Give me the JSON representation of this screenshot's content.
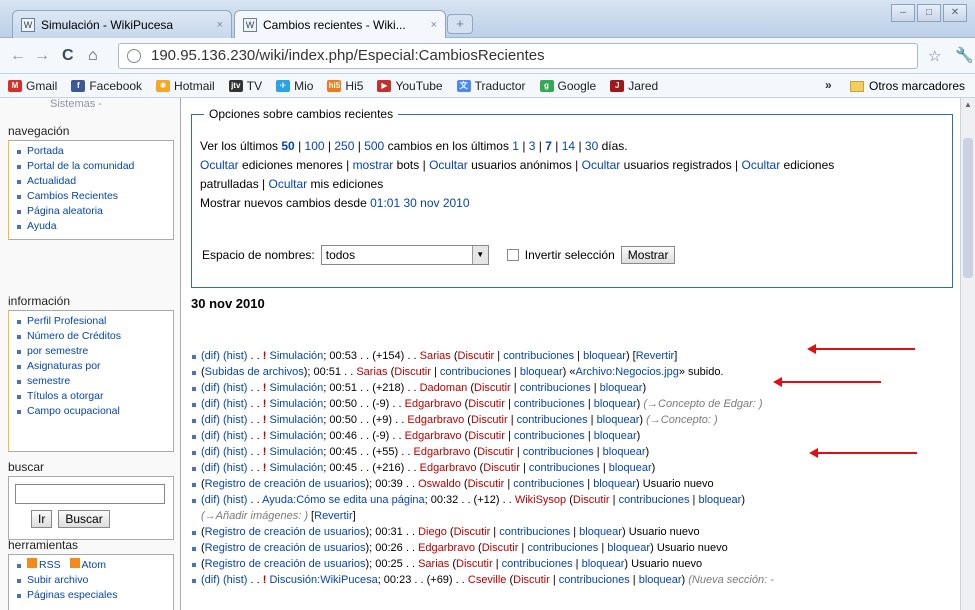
{
  "browser": {
    "tabs": [
      {
        "title": "Simulación - WikiPucesa",
        "close": "×"
      },
      {
        "title": "Cambios recientes - Wiki...",
        "close": "×"
      }
    ],
    "url": "190.95.136.230/wiki/index.php/Especial:CambiosRecientes",
    "bookmarks": [
      "Gmail",
      "Facebook",
      "Hotmail",
      "TV",
      "Mio",
      "Hi5",
      "YouTube",
      "Traductor",
      "Google",
      "Jared"
    ],
    "other_bookmarks": "Otros marcadores"
  },
  "sidebar": {
    "logo_text": "Sistemas -",
    "nav_title": "navegación",
    "nav_items": [
      "Portada",
      "Portal de la comunidad",
      "Actualidad",
      "Cambios Recientes",
      "Página aleatoria",
      "Ayuda"
    ],
    "info_title": "información",
    "info_items": [
      "Perfil Profesional",
      "Número de Créditos",
      "por semestre",
      "Asignaturas por",
      "semestre",
      "Títulos a otorgar",
      "Campo ocupacional"
    ],
    "search_title": "buscar",
    "search_go": "Ir",
    "search_btn": "Buscar",
    "tools_title": "herramientas",
    "tools_rss": "RSS",
    "tools_atom": "Atom",
    "tools_items": [
      "Subir archivo",
      "Páginas especiales"
    ]
  },
  "options": {
    "legend": "Opciones sobre cambios recientes",
    "line1_prefix": "Ver los últimos",
    "counts": [
      "50",
      "100",
      "250",
      "500"
    ],
    "line1_mid": "cambios en los últimos",
    "days": [
      "1",
      "3",
      "7",
      "14",
      "30"
    ],
    "line1_suffix": "días.",
    "hide": "Ocultar",
    "show": "mostrar",
    "l2a": "ediciones menores |",
    "l2b": "bots |",
    "l2c": "usuarios anónimos |",
    "l2d": "usuarios registrados |",
    "l2e": "ediciones",
    "l3a": "patrulladas |",
    "l3b": "mis ediciones",
    "l4": "Mostrar nuevos cambios desde",
    "since": "01:01 30 nov 2010",
    "ns_label": "Espacio de nombres:",
    "ns_value": "todos",
    "invert": "Invertir selección",
    "show_btn": "Mostrar"
  },
  "date_heading": "30 nov 2010",
  "accent": "#e01010"
}
